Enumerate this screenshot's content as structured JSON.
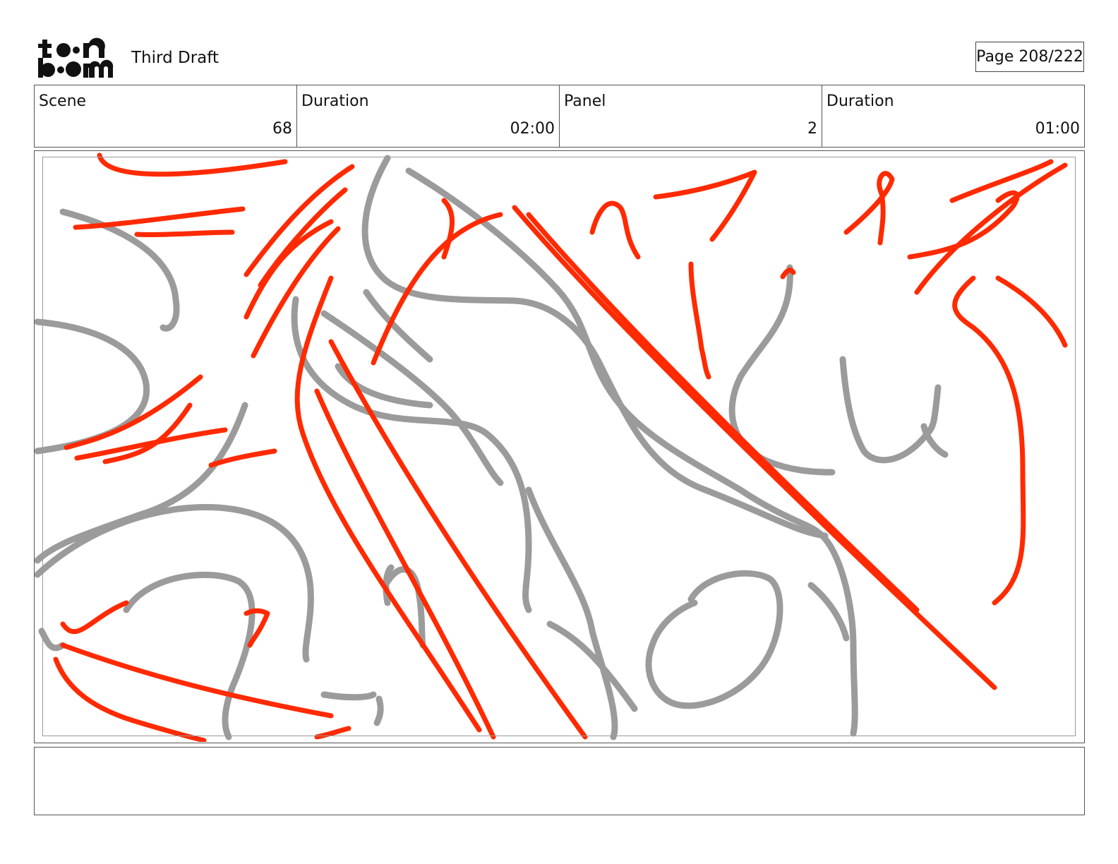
{
  "header": {
    "logo_text": "toon boom",
    "title": "Third Draft",
    "page_label": "Page 208/222"
  },
  "info": {
    "scene_label": "Scene",
    "scene_value": "68",
    "scene_duration_label": "Duration",
    "scene_duration_value": "02:00",
    "panel_label": "Panel",
    "panel_value": "2",
    "panel_duration_label": "Duration",
    "panel_duration_value": "01:00"
  },
  "sketch": {
    "red_color": "#ff2a00",
    "gray_color": "#9b9b9b"
  },
  "notes": {
    "text": ""
  }
}
